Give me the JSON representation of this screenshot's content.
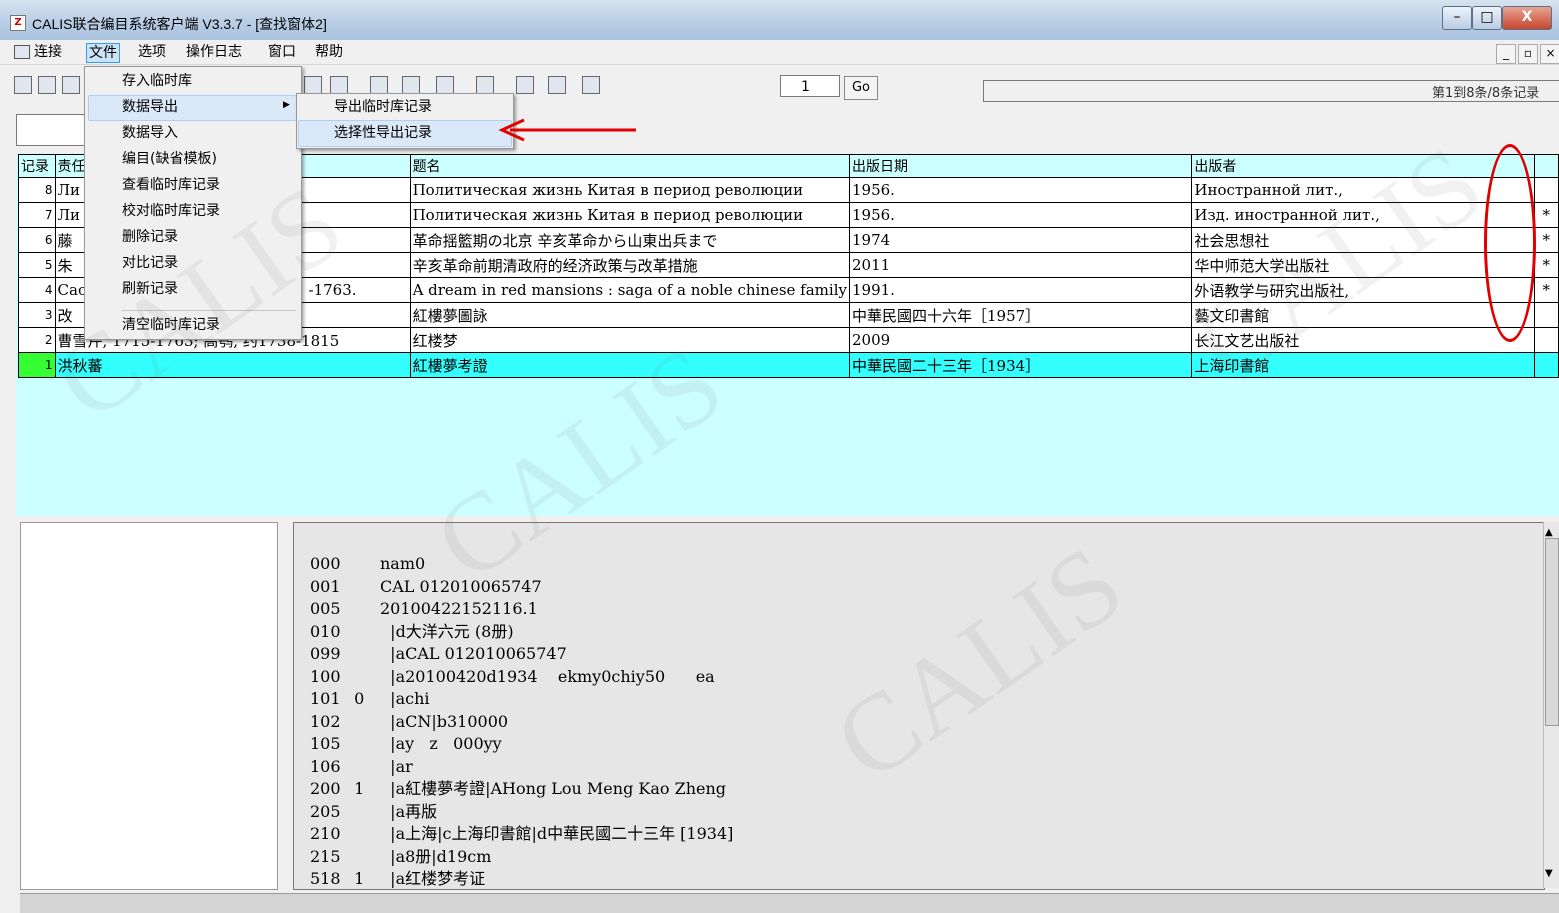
{
  "window": {
    "title": "CALIS联合编目系统客户端 V3.3.7 - [查找窗体2]",
    "icon_glyph": "Z",
    "controls": {
      "minimize": "–",
      "maximize": "□",
      "close": "X"
    }
  },
  "menubar": {
    "items": [
      "连接",
      "文件",
      "选项",
      "操作日志",
      "窗口",
      "帮助"
    ],
    "mdi_controls": {
      "minimize": "_",
      "restore": "▫",
      "close": "×"
    }
  },
  "toolbar": {
    "page_value": "1",
    "go_label": "Go",
    "record_count": "第1到8条/8条记录"
  },
  "file_menu": {
    "items": [
      "存入临时库",
      "数据导出",
      "数据导入",
      "编目(缺省模板)",
      "查看临时库记录",
      "校对临时库记录",
      "删除记录",
      "对比记录",
      "刷新记录",
      "清空临时库记录"
    ],
    "submenu_arrow": "▶",
    "export_submenu": [
      "导出临时库记录",
      "选择性导出记录"
    ]
  },
  "grid": {
    "headers": [
      "记录",
      "责任者",
      "题名",
      "出版日期",
      "出版者",
      ""
    ],
    "rows": [
      {
        "num": "8",
        "author": "Ли",
        "title": "Политическая жизнь Китая в период революции",
        "date": "1956.",
        "publisher": "Иностранной лит.,",
        "mark": ""
      },
      {
        "num": "7",
        "author": "Ли",
        "title": "Политическая жизнь Китая в период революции",
        "date": "1956.",
        "publisher": "Изд. иностранной лит.,",
        "mark": "*"
      },
      {
        "num": "6",
        "author": "藤",
        "title": "革命揺籃期の北京 辛亥革命から山東出兵まで",
        "date": "1974",
        "publisher": "社会思想社",
        "mark": "*"
      },
      {
        "num": "5",
        "author": "朱",
        "title": "辛亥革命前期清政府的经济政策与改革措施",
        "date": "2011",
        "publisher": "华中师范大学出版社",
        "mark": "*"
      },
      {
        "num": "4",
        "author": "Cao",
        "author_tail": "-1763.",
        "title": "A dream in red mansions : saga of a noble chinese family",
        "date": "1991.",
        "publisher": "外语教学与研究出版社,",
        "mark": "*"
      },
      {
        "num": "3",
        "author": "改",
        "title": "紅樓夢圖詠",
        "date": "中華民國四十六年［1957］",
        "publisher": "藝文印書館",
        "mark": ""
      },
      {
        "num": "2",
        "author": "曹雪芹, 1715-1763; 高鹗, 约1738-1815",
        "title": "红楼梦",
        "date": "2009",
        "publisher": "长江文艺出版社",
        "mark": ""
      },
      {
        "num": "1",
        "author": "洪秋蕃",
        "title": "紅樓夢考證",
        "date": "中華民國二十三年［1934］",
        "publisher": "上海印書館",
        "mark": ""
      }
    ]
  },
  "marc": {
    "lines": [
      {
        "tag": "000",
        "ind": "",
        "content": "nam0"
      },
      {
        "tag": "001",
        "ind": "",
        "content": "CAL 012010065747"
      },
      {
        "tag": "005",
        "ind": "",
        "content": "20100422152116.1"
      },
      {
        "tag": "010",
        "ind": "",
        "content": "  |d大洋六元 (8册)"
      },
      {
        "tag": "099",
        "ind": "",
        "content": "  |aCAL 012010065747"
      },
      {
        "tag": "100",
        "ind": "",
        "content": "  |a20100420d1934    ekmy0chiy50      ea"
      },
      {
        "tag": "101",
        "ind": "0",
        "content": "  |achi"
      },
      {
        "tag": "102",
        "ind": "",
        "content": "  |aCN|b310000"
      },
      {
        "tag": "105",
        "ind": "",
        "content": "  |ay   z   000yy"
      },
      {
        "tag": "106",
        "ind": "",
        "content": "  |ar"
      },
      {
        "tag": "200",
        "ind": "1",
        "content": "  |a紅樓夢考證|AHong Lou Meng Kao Zheng"
      },
      {
        "tag": "205",
        "ind": "",
        "content": "  |a再版"
      },
      {
        "tag": "210",
        "ind": "",
        "content": "  |a上海|c上海印書館|d中華民國二十三年 [1934]"
      },
      {
        "tag": "215",
        "ind": "",
        "content": "  |a8册|d19cm"
      },
      {
        "tag": "518",
        "ind": "1",
        "content": "  |a红楼梦考证"
      }
    ]
  },
  "watermark": {
    "text": "CALIS"
  },
  "colors": {
    "grid_bg": "#ccffff",
    "selected_row": "#33ffff",
    "selected_num": "#33ff33",
    "annotation": "#e00000"
  }
}
